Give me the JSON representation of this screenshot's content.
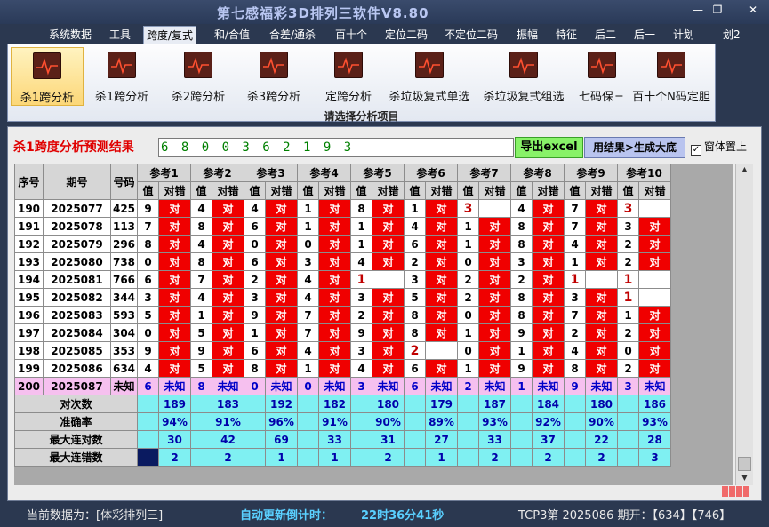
{
  "app": {
    "title": "第七感福彩3D排列三软件V8.80"
  },
  "window": {
    "min": "—",
    "restore": "❐",
    "close": "✕"
  },
  "menu": [
    "系统数据",
    "工具",
    "跨度/复式",
    "和/合值",
    "合差/通杀",
    "百十个",
    "定位二码",
    "不定位二码",
    "振幅",
    "特征",
    "后二",
    "后一",
    "计划",
    "划2"
  ],
  "menu_active_index": 2,
  "ribbon": {
    "buttons": [
      "杀1跨分析",
      "杀1跨分析",
      "杀2跨分析",
      "杀3跨分析",
      "定跨分析",
      "杀垃圾复式单选",
      "杀垃圾复式组选",
      "七码保三",
      "百十个N码定胆"
    ],
    "active_index": 0,
    "caption": "请选择分析项目"
  },
  "result": {
    "label": "杀1跨度分析预测结果",
    "digits": "6 8 0 0 3 6 2 1 9 3",
    "excel_btn": "导出excel",
    "gen_btn": "用结果>生成大底",
    "topmost_label": "窗体置上",
    "topmost_checked": "✓"
  },
  "table": {
    "headers": {
      "seq": "序号",
      "period": "期号",
      "code": "号码",
      "value": "值",
      "check": "对错"
    },
    "refs": [
      "参考1",
      "参考2",
      "参考3",
      "参考4",
      "参考5",
      "参考6",
      "参考7",
      "参考8",
      "参考9",
      "参考10"
    ],
    "ok_text": "对",
    "rows": [
      {
        "seq": "190",
        "period": "2025077",
        "code": "425",
        "vals": [
          "9",
          "4",
          "4",
          "1",
          "8",
          "1",
          "3",
          "4",
          "7",
          "3"
        ],
        "ok": [
          1,
          1,
          1,
          1,
          1,
          1,
          0,
          1,
          1,
          0
        ]
      },
      {
        "seq": "191",
        "period": "2025078",
        "code": "113",
        "vals": [
          "7",
          "8",
          "6",
          "1",
          "1",
          "4",
          "1",
          "8",
          "7",
          "3"
        ],
        "ok": [
          1,
          1,
          1,
          1,
          1,
          1,
          1,
          1,
          1,
          1
        ]
      },
      {
        "seq": "192",
        "period": "2025079",
        "code": "296",
        "vals": [
          "8",
          "4",
          "0",
          "0",
          "1",
          "6",
          "1",
          "8",
          "4",
          "2"
        ],
        "ok": [
          1,
          1,
          1,
          1,
          1,
          1,
          1,
          1,
          1,
          1
        ]
      },
      {
        "seq": "193",
        "period": "2025080",
        "code": "738",
        "vals": [
          "0",
          "8",
          "6",
          "3",
          "4",
          "2",
          "0",
          "3",
          "1",
          "2"
        ],
        "ok": [
          1,
          1,
          1,
          1,
          1,
          1,
          1,
          1,
          1,
          1
        ]
      },
      {
        "seq": "194",
        "period": "2025081",
        "code": "766",
        "vals": [
          "6",
          "7",
          "2",
          "4",
          "1",
          "3",
          "2",
          "2",
          "1",
          "1"
        ],
        "ok": [
          1,
          1,
          1,
          1,
          0,
          1,
          1,
          1,
          0,
          0
        ]
      },
      {
        "seq": "195",
        "period": "2025082",
        "code": "344",
        "vals": [
          "3",
          "4",
          "3",
          "4",
          "3",
          "5",
          "2",
          "8",
          "3",
          "1"
        ],
        "ok": [
          1,
          1,
          1,
          1,
          1,
          1,
          1,
          1,
          1,
          0
        ]
      },
      {
        "seq": "196",
        "period": "2025083",
        "code": "593",
        "vals": [
          "5",
          "1",
          "9",
          "7",
          "2",
          "8",
          "0",
          "8",
          "7",
          "1"
        ],
        "ok": [
          1,
          1,
          1,
          1,
          1,
          1,
          1,
          1,
          1,
          1
        ]
      },
      {
        "seq": "197",
        "period": "2025084",
        "code": "304",
        "vals": [
          "0",
          "5",
          "1",
          "7",
          "9",
          "8",
          "1",
          "9",
          "2",
          "2"
        ],
        "ok": [
          1,
          1,
          1,
          1,
          1,
          1,
          1,
          1,
          1,
          1
        ]
      },
      {
        "seq": "198",
        "period": "2025085",
        "code": "353",
        "vals": [
          "9",
          "9",
          "6",
          "4",
          "3",
          "2",
          "0",
          "1",
          "4",
          "0"
        ],
        "ok": [
          1,
          1,
          1,
          1,
          1,
          0,
          1,
          1,
          1,
          1
        ]
      },
      {
        "seq": "199",
        "period": "2025086",
        "code": "634",
        "vals": [
          "4",
          "5",
          "8",
          "1",
          "4",
          "6",
          "1",
          "9",
          "8",
          "2"
        ],
        "ok": [
          1,
          1,
          1,
          1,
          1,
          1,
          1,
          1,
          1,
          1
        ]
      }
    ],
    "unknown_row": {
      "seq": "200",
      "period": "2025087",
      "code": "未知",
      "vals": [
        "6",
        "8",
        "0",
        "0",
        "3",
        "6",
        "2",
        "1",
        "9",
        "3"
      ],
      "text": "未知"
    },
    "stats": [
      {
        "label": "对次数",
        "vals": [
          "189",
          "183",
          "192",
          "182",
          "180",
          "179",
          "187",
          "184",
          "180",
          "186"
        ]
      },
      {
        "label": "准确率",
        "vals": [
          "94%",
          "91%",
          "96%",
          "91%",
          "90%",
          "89%",
          "93%",
          "92%",
          "90%",
          "93%"
        ]
      },
      {
        "label": "最大连对数",
        "vals": [
          "30",
          "42",
          "69",
          "33",
          "31",
          "27",
          "33",
          "37",
          "22",
          "28"
        ]
      },
      {
        "label": "最大连错数",
        "vals": [
          "2",
          "2",
          "1",
          "1",
          "2",
          "1",
          "2",
          "2",
          "2",
          "3"
        ]
      }
    ]
  },
  "status": {
    "current": "当前数据为：[体彩排列三]",
    "countdown_label": "自动更新倒计时：",
    "countdown": "22时36分41秒",
    "draw": "TCP3第 2025086 期开：【634】【746】"
  }
}
